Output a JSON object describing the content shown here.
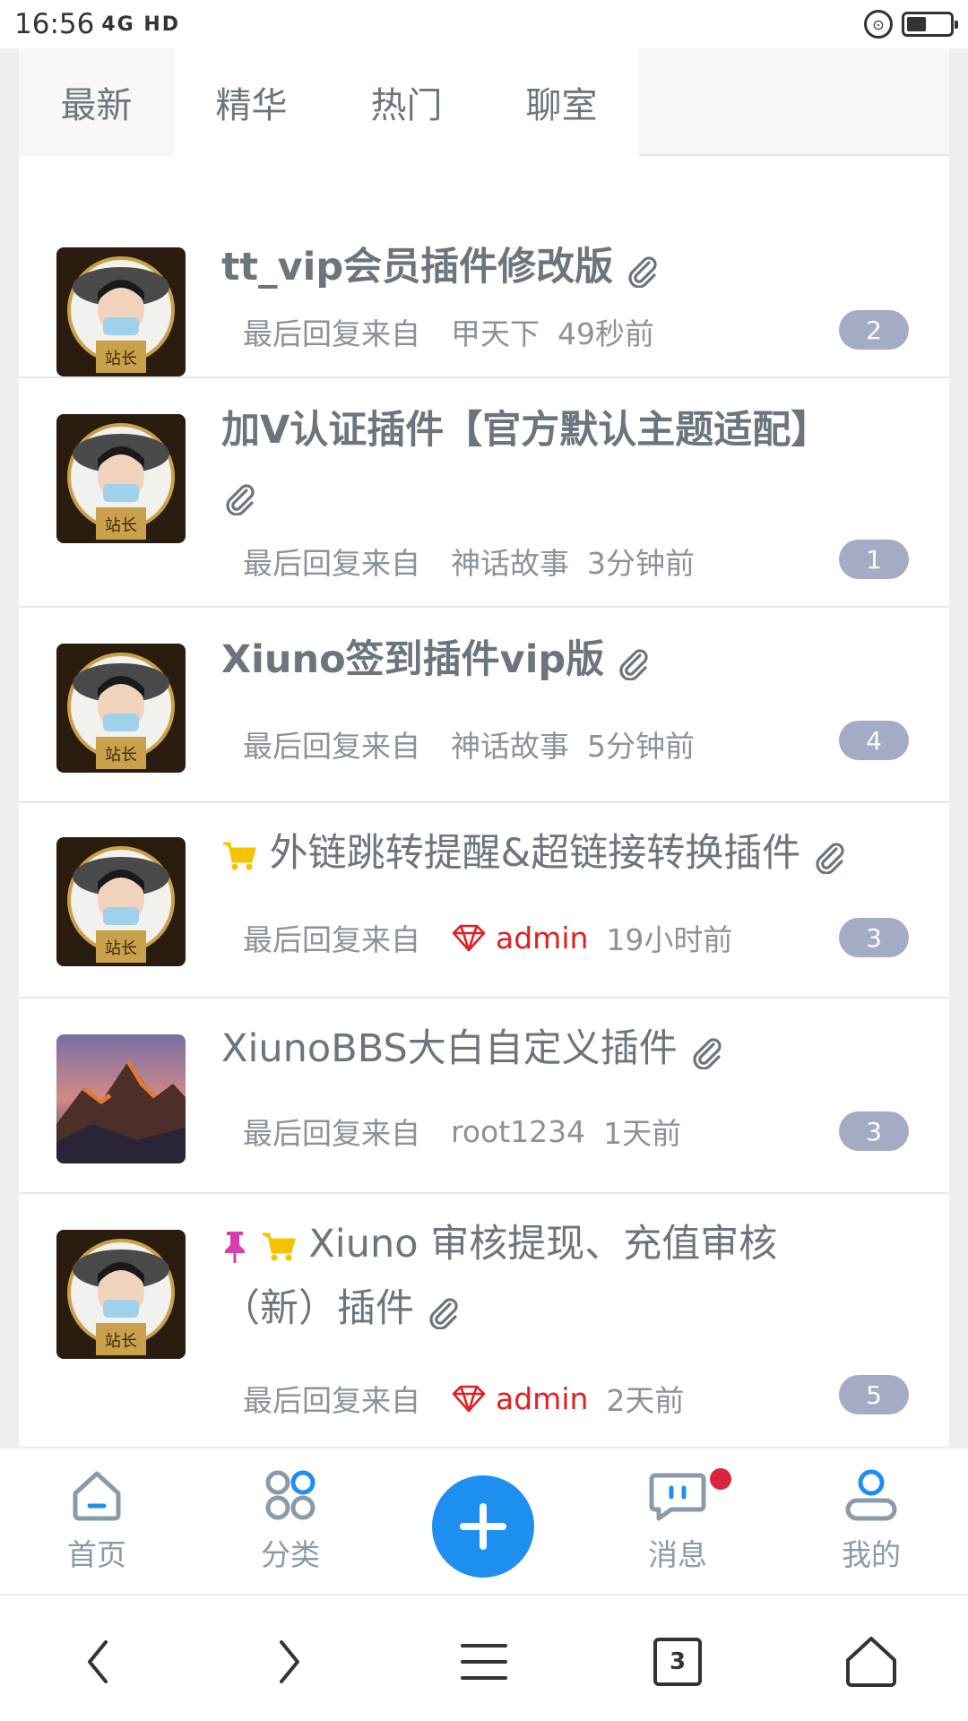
{
  "status_bar": {
    "time": "16:56",
    "network_icons": "4G HD",
    "battery_level": 0.45
  },
  "tabs": [
    {
      "label": "最新"
    },
    {
      "label": "精华"
    },
    {
      "label": "热门"
    },
    {
      "label": "聊室"
    }
  ],
  "threads": [
    {
      "title": "tt_vip会员插件修改版",
      "title_line2": "",
      "meta_prefix": "最后回复来自",
      "last_user": "甲天下",
      "time": "49秒前",
      "replies": "2",
      "avatar_caption": "站长"
    },
    {
      "title": "加V认证插件【官方默认主题适配】",
      "title_line2": "",
      "meta_prefix": "最后回复来自",
      "last_user": "神话故事",
      "time": "3分钟前",
      "replies": "1",
      "avatar_caption": "站长"
    },
    {
      "title": "Xiuno签到插件vip版",
      "title_line2": "",
      "meta_prefix": "最后回复来自",
      "last_user": "神话故事",
      "time": "5分钟前",
      "replies": "4",
      "avatar_caption": "站长"
    },
    {
      "title": "外链跳转提醒&超链接转换插件",
      "title_line2": "",
      "meta_prefix": "最后回复来自",
      "last_user": "admin",
      "time": "19小时前",
      "replies": "3",
      "avatar_caption": "站长"
    },
    {
      "title": "XiunoBBS大白自定义插件",
      "title_line2": "",
      "meta_prefix": "最后回复来自",
      "last_user": "root1234",
      "time": "1天前",
      "replies": "3",
      "avatar_caption": ""
    },
    {
      "title": "Xiuno 审核提现、充值审核",
      "title_line2": "（新）插件",
      "meta_prefix": "最后回复来自",
      "last_user": "admin",
      "time": "2天前",
      "replies": "5",
      "avatar_caption": "站长"
    }
  ],
  "bottom_nav": [
    {
      "label": "首页",
      "icon": "home-icon"
    },
    {
      "label": "分类",
      "icon": "category-icon"
    },
    {
      "label": "",
      "icon": "plus-icon"
    },
    {
      "label": "消息",
      "icon": "message-icon"
    },
    {
      "label": "我的",
      "icon": "user-icon"
    }
  ],
  "colors": {
    "accent": "#1e8ff0",
    "badge": "#a4abc4",
    "admin": "#e02020",
    "cart": "#f5c400",
    "pin": "#d63fa9"
  },
  "browser": {
    "tab_count": "3"
  }
}
